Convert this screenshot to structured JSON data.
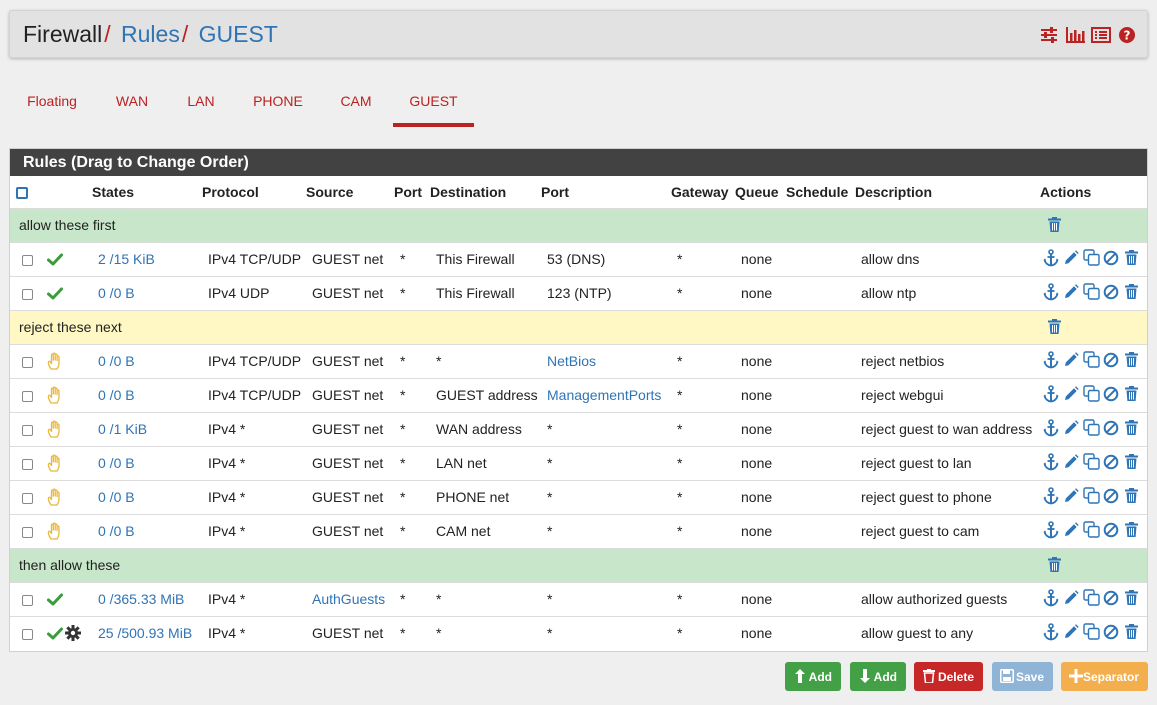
{
  "breadcrumb": {
    "root": "Firewall",
    "sep": "/",
    "rules": "Rules",
    "current": "GUEST"
  },
  "header_icons": [
    "sliders-icon",
    "bar-chart-icon",
    "list-icon",
    "help-icon"
  ],
  "tabs": [
    "Floating",
    "WAN",
    "LAN",
    "PHONE",
    "CAM",
    "GUEST"
  ],
  "active_tab": "GUEST",
  "panel_title": "Rules (Drag to Change Order)",
  "columns": [
    "States",
    "Protocol",
    "Source",
    "Port",
    "Destination",
    "Port",
    "Gateway",
    "Queue",
    "Schedule",
    "Description",
    "Actions"
  ],
  "rows": [
    {
      "kind": "separator",
      "color": "green",
      "label": "allow these first"
    },
    {
      "kind": "rule",
      "status": "pass",
      "states": "2 /15 KiB",
      "protocol": "IPv4 TCP/UDP",
      "source": "GUEST net",
      "source_link": false,
      "sport": "*",
      "destination": "This Firewall",
      "dport": "53 (DNS)",
      "dport_link": false,
      "gateway": "*",
      "queue": "none",
      "schedule": "",
      "description": "allow dns"
    },
    {
      "kind": "rule",
      "status": "pass",
      "states": "0 /0 B",
      "protocol": "IPv4 UDP",
      "source": "GUEST net",
      "source_link": false,
      "sport": "*",
      "destination": "This Firewall",
      "dport": "123 (NTP)",
      "dport_link": false,
      "gateway": "*",
      "queue": "none",
      "schedule": "",
      "description": "allow ntp"
    },
    {
      "kind": "separator",
      "color": "yellow",
      "label": "reject these next"
    },
    {
      "kind": "rule",
      "status": "reject",
      "states": "0 /0 B",
      "protocol": "IPv4 TCP/UDP",
      "source": "GUEST net",
      "source_link": false,
      "sport": "*",
      "destination": "*",
      "dport": "NetBios",
      "dport_link": true,
      "gateway": "*",
      "queue": "none",
      "schedule": "",
      "description": "reject netbios"
    },
    {
      "kind": "rule",
      "status": "reject",
      "states": "0 /0 B",
      "protocol": "IPv4 TCP/UDP",
      "source": "GUEST net",
      "source_link": false,
      "sport": "*",
      "destination": "GUEST address",
      "dport": "ManagementPorts",
      "dport_link": true,
      "gateway": "*",
      "queue": "none",
      "schedule": "",
      "description": "reject webgui"
    },
    {
      "kind": "rule",
      "status": "reject",
      "states": "0 /1 KiB",
      "protocol": "IPv4 *",
      "source": "GUEST net",
      "source_link": false,
      "sport": "*",
      "destination": "WAN address",
      "dport": "*",
      "dport_link": false,
      "gateway": "*",
      "queue": "none",
      "schedule": "",
      "description": "reject guest to wan address"
    },
    {
      "kind": "rule",
      "status": "reject",
      "states": "0 /0 B",
      "protocol": "IPv4 *",
      "source": "GUEST net",
      "source_link": false,
      "sport": "*",
      "destination": "LAN net",
      "dport": "*",
      "dport_link": false,
      "gateway": "*",
      "queue": "none",
      "schedule": "",
      "description": "reject guest to lan"
    },
    {
      "kind": "rule",
      "status": "reject",
      "states": "0 /0 B",
      "protocol": "IPv4 *",
      "source": "GUEST net",
      "source_link": false,
      "sport": "*",
      "destination": "PHONE net",
      "dport": "*",
      "dport_link": false,
      "gateway": "*",
      "queue": "none",
      "schedule": "",
      "description": "reject guest to phone"
    },
    {
      "kind": "rule",
      "status": "reject",
      "states": "0 /0 B",
      "protocol": "IPv4 *",
      "source": "GUEST net",
      "source_link": false,
      "sport": "*",
      "destination": "CAM net",
      "dport": "*",
      "dport_link": false,
      "gateway": "*",
      "queue": "none",
      "schedule": "",
      "description": "reject guest to cam"
    },
    {
      "kind": "separator",
      "color": "green",
      "label": "then allow these"
    },
    {
      "kind": "rule",
      "status": "pass",
      "states": "0 /365.33 MiB",
      "protocol": "IPv4 *",
      "source": "AuthGuests",
      "source_link": true,
      "sport": "*",
      "destination": "*",
      "dport": "*",
      "dport_link": false,
      "gateway": "*",
      "queue": "none",
      "schedule": "",
      "description": "allow authorized guests"
    },
    {
      "kind": "rule",
      "status": "pass-advanced",
      "states": "25 /500.93 MiB",
      "protocol": "IPv4 *",
      "source": "GUEST net",
      "source_link": false,
      "sport": "*",
      "destination": "*",
      "dport": "*",
      "dport_link": false,
      "gateway": "*",
      "queue": "none",
      "schedule": "",
      "description": "allow guest to any"
    }
  ],
  "buttons": {
    "add_top": "Add",
    "add_bottom": "Add",
    "delete": "Delete",
    "save": "Save",
    "separator": "Separator"
  },
  "colors": {
    "pass": "#3a9d3a",
    "reject": "#e8b83a",
    "link": "#2f74b5",
    "accent": "#b22222",
    "add": "#43a047",
    "delete": "#c62828",
    "save": "#90b4d6",
    "separator": "#f3ae4e"
  }
}
